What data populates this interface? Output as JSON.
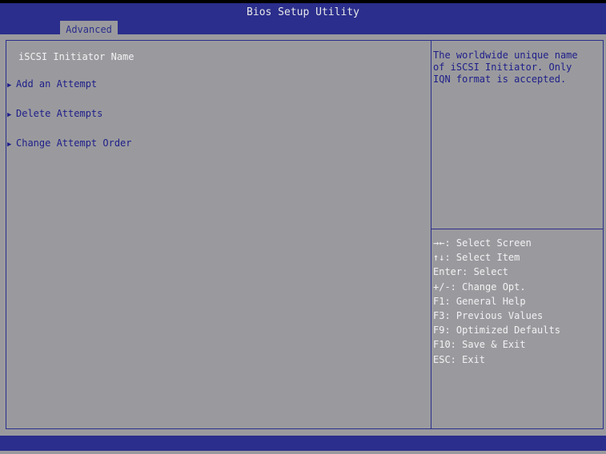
{
  "header": {
    "title": "Bios Setup Utility",
    "tab": "Advanced"
  },
  "menu": {
    "items": [
      {
        "label": "iSCSI Initiator Name",
        "submenu": false
      },
      {
        "label": "Add an Attempt",
        "submenu": true
      },
      {
        "label": "Delete Attempts",
        "submenu": true
      },
      {
        "label": "Change Attempt Order",
        "submenu": true
      }
    ]
  },
  "help": {
    "text": "The worldwide unique name\nof iSCSI Initiator. Only\nIQN format is accepted."
  },
  "keys": [
    "→←: Select Screen",
    "↑↓: Select Item",
    "Enter: Select",
    "+/-: Change Opt.",
    "F1: General Help",
    "F3: Previous Values",
    "F9: Optimized Defaults",
    "F10: Save & Exit",
    "ESC: Exit"
  ],
  "colors": {
    "background": "#9a9a9e",
    "bar": "#2b2e8c",
    "highlight_text": "#f2f2f4",
    "text": "#1e1e8a"
  }
}
